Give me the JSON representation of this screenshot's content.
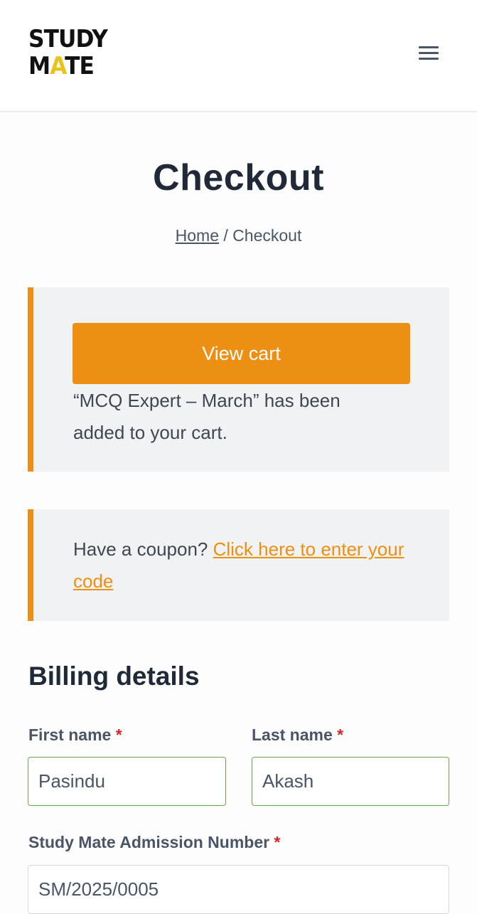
{
  "header": {
    "logo": {
      "line1": "STUDY",
      "line2_part1": "M",
      "line2_accent": "A",
      "line2_part2": "TE"
    },
    "menu_icon": "hamburger-menu-icon"
  },
  "page": {
    "title": "Checkout",
    "breadcrumb": {
      "home": "Home",
      "separator": " / ",
      "current": "Checkout"
    }
  },
  "cart_notice": {
    "button_label": "View cart",
    "message": "“MCQ Expert – March” has been added to your cart."
  },
  "coupon_notice": {
    "text": "Have a coupon? ",
    "link": "Click here to enter your code"
  },
  "billing": {
    "title": "Billing details",
    "required_mark": "*",
    "first_name": {
      "label": "First name",
      "value": "Pasindu"
    },
    "last_name": {
      "label": "Last name",
      "value": "Akash"
    },
    "admission_number": {
      "label": "Study Mate Admission Number",
      "value": "SM/2025/0005"
    }
  },
  "colors": {
    "accent": "#ec8f12",
    "logo_accent": "#e8c41a",
    "valid_border": "#6aa84f",
    "required": "#d3262a"
  }
}
